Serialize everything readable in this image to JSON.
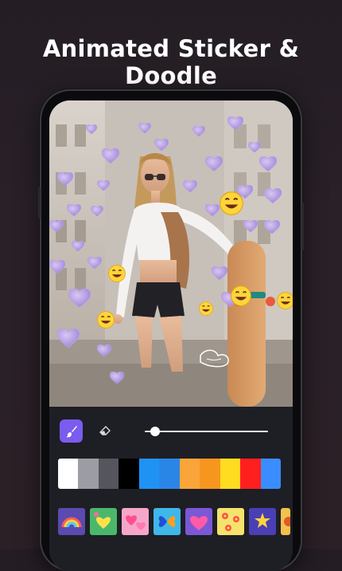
{
  "headline": "Animated Sticker & Doodle",
  "icons": {
    "brush": "brush-icon",
    "eraser": "eraser-icon"
  },
  "brush_size_level": 0.05,
  "palette": [
    "#ffffff",
    "#9c9ca4",
    "#55555e",
    "#000000",
    "#1f93f3",
    "#2a86e6",
    "#f9a53a",
    "#f7961e",
    "#ffdc1f",
    "#ff1f1f",
    "#3a8dff"
  ],
  "stickers": [
    {
      "name": "rainbow-sticker",
      "bg": "#5b4ab0"
    },
    {
      "name": "green-hearts-sticker",
      "bg": "#4ab86a"
    },
    {
      "name": "pink-hearts-sticker",
      "bg": "#f6a7c9"
    },
    {
      "name": "butterfly-sticker",
      "bg": "#3fb7e8"
    },
    {
      "name": "love-hearts-sticker",
      "bg": "#7a58d6"
    },
    {
      "name": "flowers-sticker",
      "bg": "#f5e36b"
    },
    {
      "name": "stars-sticker",
      "bg": "#4a3fb5"
    },
    {
      "name": "partial-sticker",
      "bg": "#f2c14e"
    }
  ],
  "colors": {
    "accent": "#7a5cf0",
    "background": "#241d24",
    "toolbar": "#1e1e25"
  }
}
